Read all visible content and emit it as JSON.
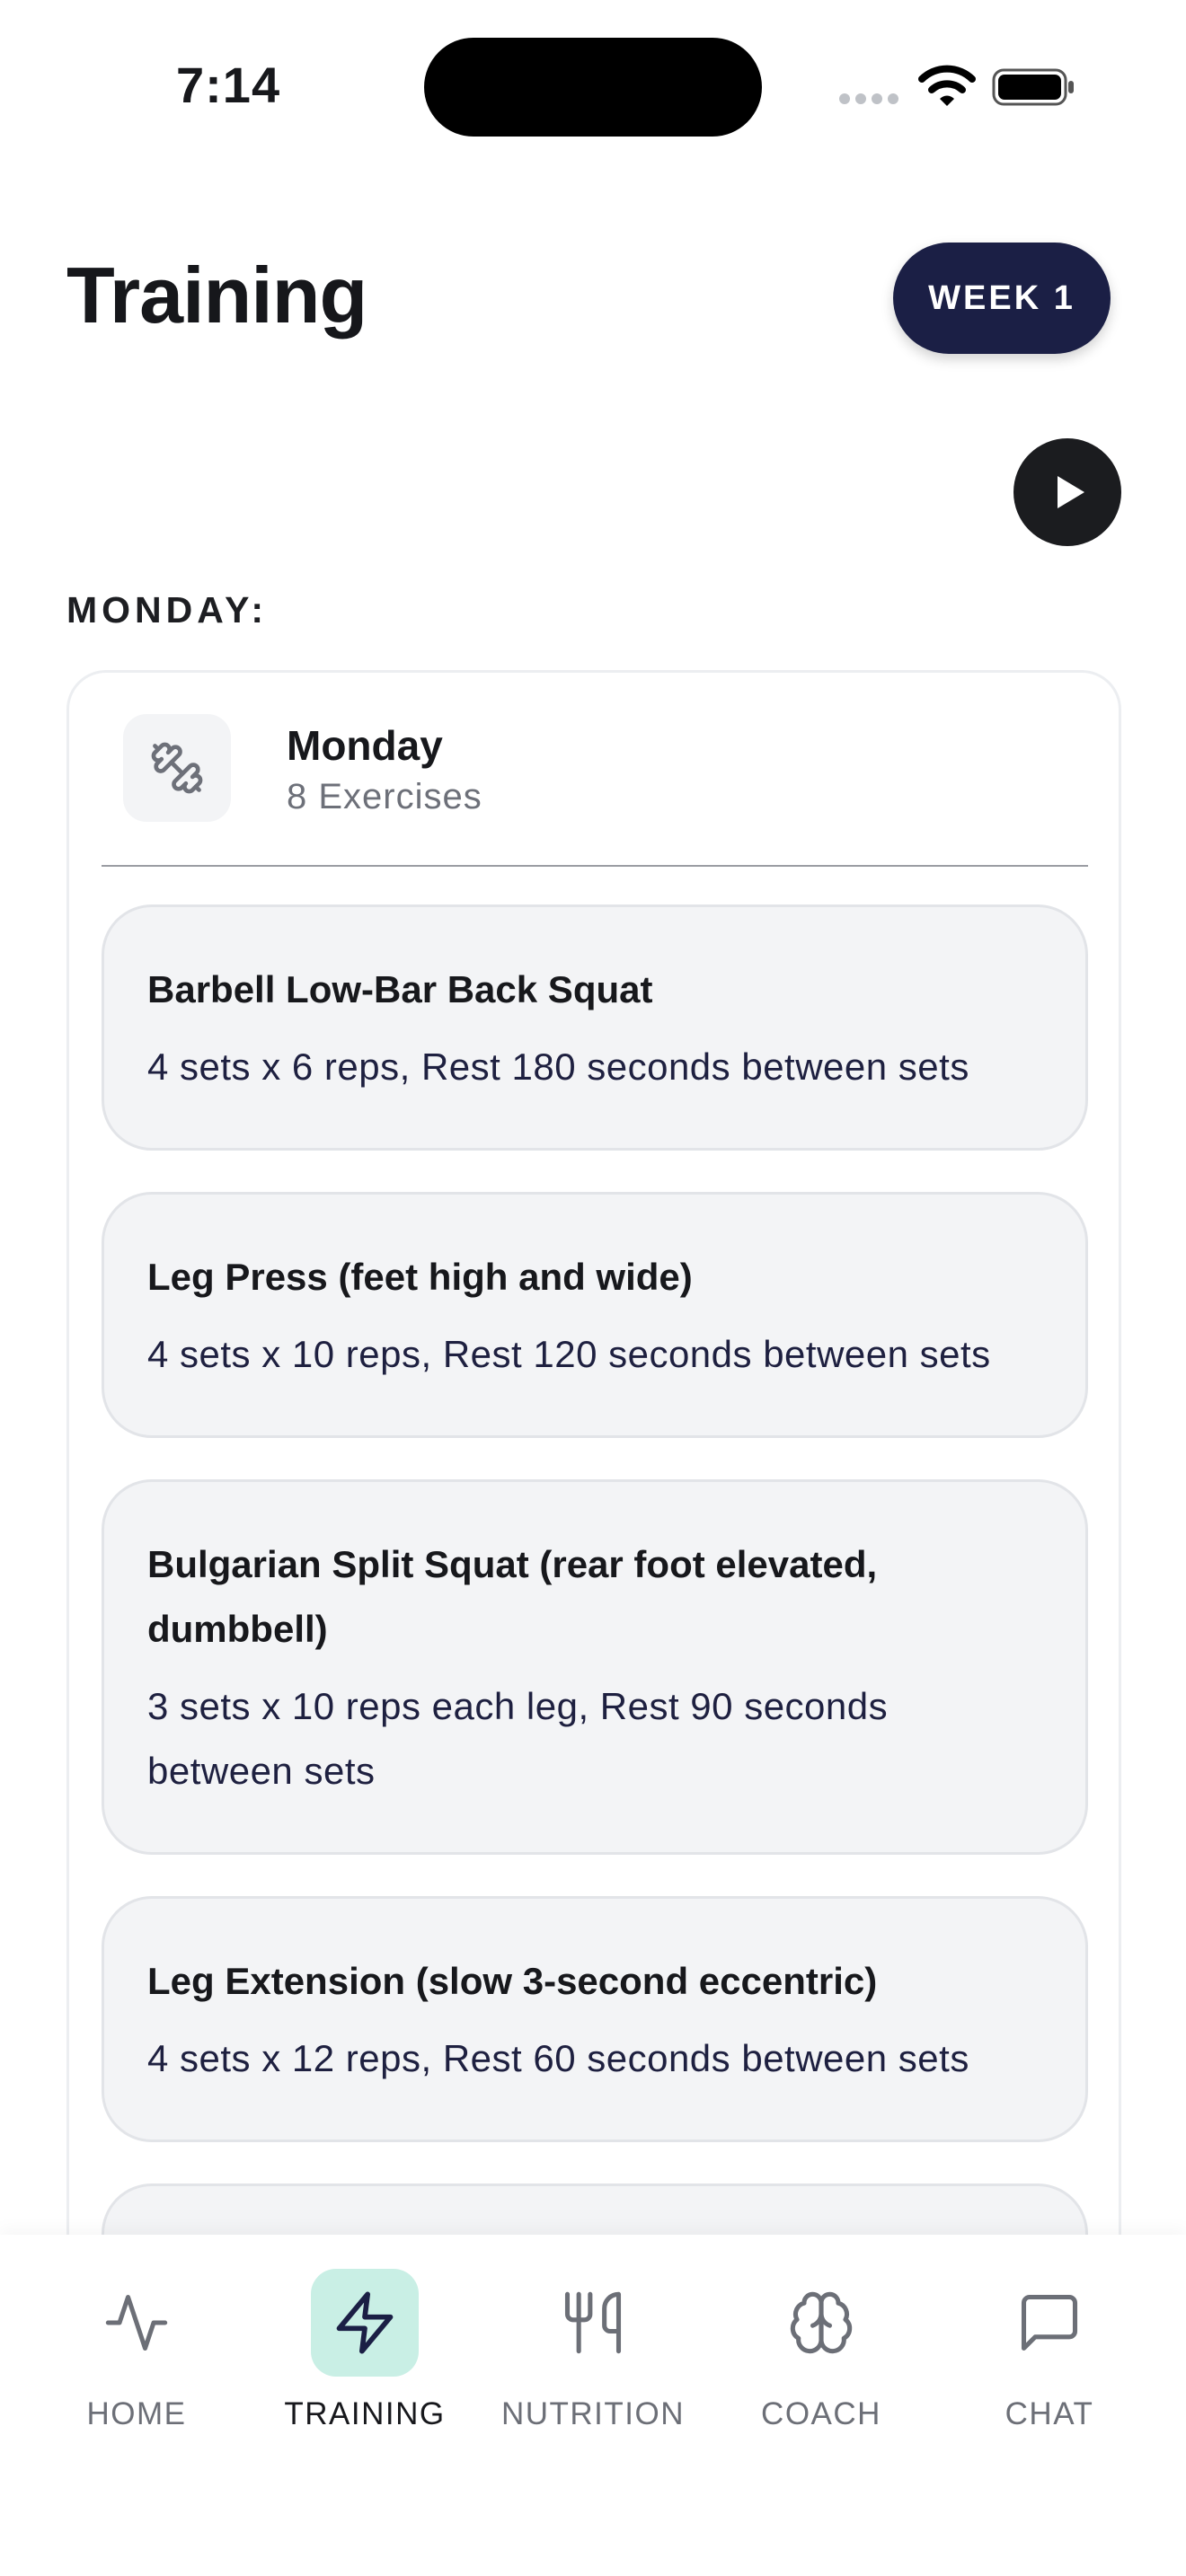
{
  "status_bar": {
    "time": "7:14"
  },
  "header": {
    "title": "Training",
    "week_badge": "WEEK 1"
  },
  "section": {
    "day_heading": "MONDAY:"
  },
  "day_card": {
    "title": "Monday",
    "count": "8 Exercises",
    "exercises": [
      {
        "name": "Barbell Low-Bar Back Squat",
        "detail": "4 sets x 6 reps, Rest 180 seconds between sets"
      },
      {
        "name": "Leg Press (feet high and wide)",
        "detail": "4 sets x 10 reps, Rest 120 seconds between sets"
      },
      {
        "name": "Bulgarian Split Squat (rear foot elevated, dumbbell)",
        "detail": "3 sets x 10 reps each leg, Rest 90 seconds between sets"
      },
      {
        "name": "Leg Extension (slow 3-second eccentric)",
        "detail": "4 sets x 12 reps, Rest 60 seconds between sets"
      },
      {
        "name": "",
        "detail": ""
      }
    ]
  },
  "tab_bar": {
    "active": "training",
    "items": [
      {
        "label": "HOME",
        "icon": "activity-icon"
      },
      {
        "label": "TRAINING",
        "icon": "lightning-icon"
      },
      {
        "label": "NUTRITION",
        "icon": "utensils-icon"
      },
      {
        "label": "COACH",
        "icon": "brain-icon"
      },
      {
        "label": "CHAT",
        "icon": "chat-bubble-icon"
      }
    ]
  },
  "colors": {
    "accent_dark": "#1b1f45",
    "active_tab_bg": "#c9efe5",
    "card_bg": "#f3f4f6"
  }
}
